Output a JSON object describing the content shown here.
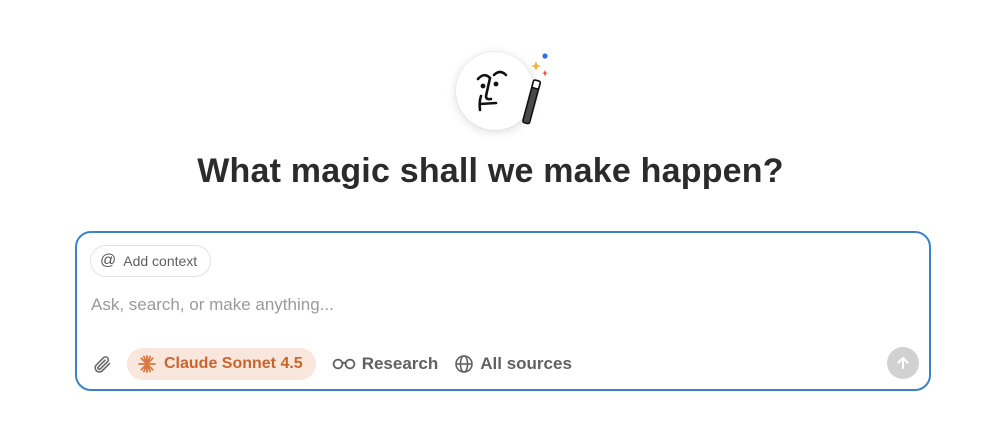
{
  "header": {
    "title": "What magic shall we make happen?",
    "avatar_icon": "face-with-magic-wand-icon"
  },
  "composer": {
    "add_context_label": "Add context",
    "placeholder": "Ask, search, or make anything...",
    "value": "",
    "model": {
      "label": "Claude Sonnet 4.5",
      "icon": "claude-burst-icon"
    },
    "tools": [
      {
        "label": "Research",
        "icon": "glasses-icon"
      },
      {
        "label": "All sources",
        "icon": "globe-icon"
      }
    ],
    "send_icon": "arrow-up-icon"
  },
  "colors": {
    "accent_border": "#3b83c9",
    "model_pill_bg": "#f9e6dc",
    "model_pill_text": "#c9652e",
    "send_disabled": "#d1d1d1",
    "sparkle_blue": "#2f6fe0",
    "sparkle_yellow": "#f3b234",
    "sparkle_red": "#e8593a"
  }
}
